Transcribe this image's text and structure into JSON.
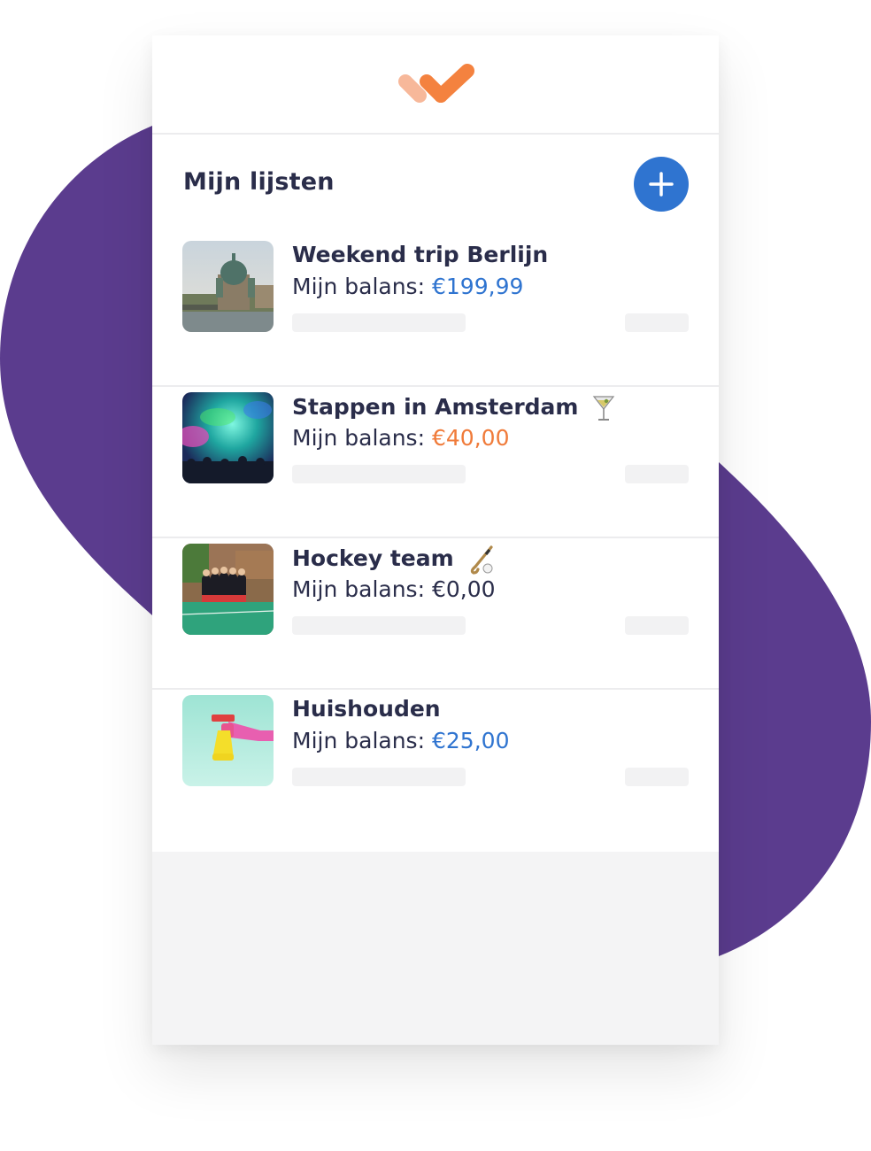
{
  "colors": {
    "background_blob": "#5b3c8e",
    "add_button": "#2f74d0",
    "text_primary": "#2a2d4a",
    "amount_blue": "#2f74d0",
    "amount_orange": "#f07b3a",
    "amount_neutral": "#2a2d4a",
    "logo_light": "#f7b89a",
    "logo_dark": "#f4823f"
  },
  "header": {
    "logo_icon": "double-checkmark-logo-icon"
  },
  "lists_section": {
    "title": "Mijn lijsten",
    "add_icon": "plus-icon"
  },
  "lists": [
    {
      "title": "Weekend trip Berlijn",
      "balance_label": "Mijn balans:",
      "amount": "€199,99",
      "amount_color": "#2f74d0",
      "thumbnail": "berlin-cathedral-photo"
    },
    {
      "title": "Stappen in Amsterdam",
      "emoji": "cocktail-glass-emoji",
      "balance_label": "Mijn balans:",
      "amount": "€40,00",
      "amount_color": "#f07b3a",
      "thumbnail": "concert-lights-photo"
    },
    {
      "title": "Hockey team",
      "emoji": "field-hockey-emoji",
      "balance_label": "Mijn balans:",
      "amount": "€0,00",
      "amount_color": "#2a2d4a",
      "thumbnail": "hockey-team-photo"
    },
    {
      "title": "Huishouden",
      "balance_label": "Mijn balans:",
      "amount": "€25,00",
      "amount_color": "#2f74d0",
      "thumbnail": "cleaning-spray-photo"
    }
  ]
}
